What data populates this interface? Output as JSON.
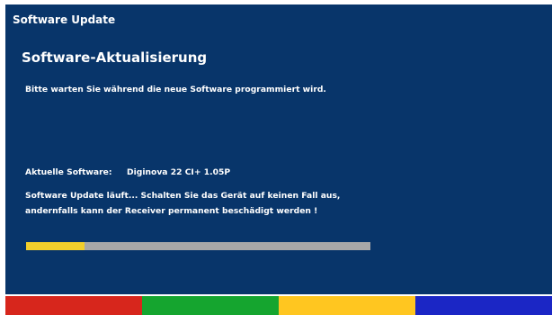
{
  "window": {
    "title": "Software Update"
  },
  "update": {
    "heading": "Software-Aktualisierung",
    "wait_message": "Bitte warten Sie während die neue Software programmiert wird.",
    "current_software_label": "Aktuelle Software:",
    "current_software_value": "Diginova 22 CI+ 1.05P",
    "warning_line_1": "Software Update läuft... Schalten Sie das Gerät auf keinen Fall aus,",
    "warning_line_2": "andernfalls kann der Receiver permanent beschädigt werden !",
    "progress_percent": 17
  },
  "colors": {
    "background": "#08356a",
    "progress_track": "#a8a8a8",
    "progress_fill": "#f2cf2c",
    "keys": {
      "red": "#d7261c",
      "green": "#15a52f",
      "yellow": "#ffc620",
      "blue": "#1b26c5"
    }
  }
}
